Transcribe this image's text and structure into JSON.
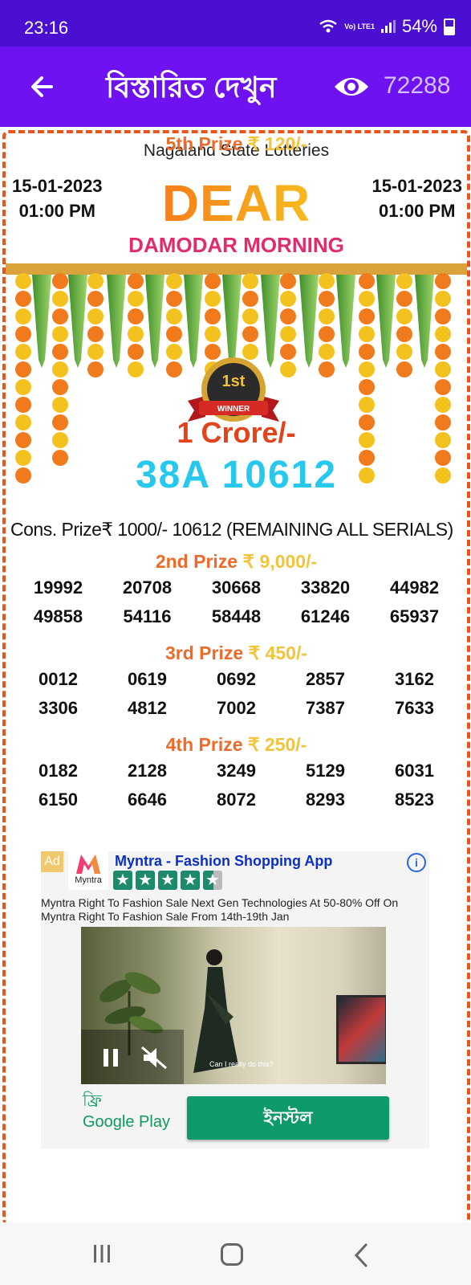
{
  "status_bar": {
    "time": "23:16",
    "network": "Vo) LTE1",
    "battery": "54%"
  },
  "app_bar": {
    "title": "বিস্তারিত দেখুন",
    "views": "72288"
  },
  "result": {
    "state_name": "Nagaland State Lotteries",
    "date": "15-01-2023",
    "time": "01:00 PM",
    "brand": "DEAR",
    "draw_name": "DAMODAR MORNING",
    "badge_rank": "1st",
    "badge_text": "WINNER",
    "first_prize_amount": "1 Crore/-",
    "first_prize_number": "38A 10612",
    "consolation": "Cons. Prize₹ 1000/- 10612 (REMAINING ALL SERIALS)",
    "prizes": [
      {
        "label": "2nd Prize",
        "amount": "₹ 9,000/-",
        "numbers": [
          "19992",
          "20708",
          "30668",
          "33820",
          "44982",
          "49858",
          "54116",
          "58448",
          "61246",
          "65937"
        ]
      },
      {
        "label": "3rd Prize",
        "amount": "₹ 450/-",
        "numbers": [
          "0012",
          "0619",
          "0692",
          "2857",
          "3162",
          "3306",
          "4812",
          "7002",
          "7387",
          "7633"
        ]
      },
      {
        "label": "4th Prize",
        "amount": "₹ 250/-",
        "numbers": [
          "0182",
          "2128",
          "3249",
          "5129",
          "6031",
          "6150",
          "6646",
          "8072",
          "8293",
          "8523"
        ]
      }
    ],
    "next_prize": {
      "label": "5th Prize",
      "amount": "₹ 120/-"
    }
  },
  "ad": {
    "tag": "Ad",
    "brand": "Myntra",
    "title": "Myntra - Fashion Shopping App",
    "rating": 4.5,
    "description": "Myntra Right To Fashion Sale Next Gen Technologies At 50-80% Off On Myntra Right To Fashion Sale From 14th-19th Jan",
    "video_caption": "Can I really do this?",
    "price": "ফ্রি",
    "store": "Google Play",
    "install_label": "ইনস্টল"
  },
  "colors": {
    "status_bar": "#4a0fd0",
    "app_bar": "#6f12f2",
    "card_border": "#e8541b",
    "first_prize_number": "#26c8ee",
    "install": "#0f9a6b"
  }
}
